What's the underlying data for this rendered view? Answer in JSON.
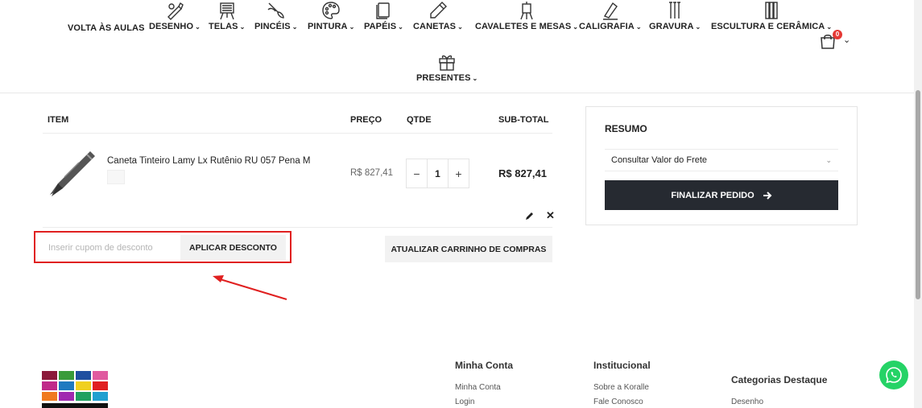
{
  "nav": {
    "items": [
      {
        "label": "VOLTA ÀS AULAS",
        "icon": "back-to-school-icon",
        "chevron": false
      },
      {
        "label": "DESENHO",
        "icon": "drawing-icon",
        "chevron": true
      },
      {
        "label": "TELAS",
        "icon": "canvas-easel-icon",
        "chevron": true
      },
      {
        "label": "PINCÉIS",
        "icon": "brush-icon",
        "chevron": true
      },
      {
        "label": "PINTURA",
        "icon": "palette-icon",
        "chevron": true
      },
      {
        "label": "PAPÉIS",
        "icon": "paper-icon",
        "chevron": true
      },
      {
        "label": "CANETAS",
        "icon": "pen-icon",
        "chevron": true
      },
      {
        "label": "CAVALETES E MESAS",
        "icon": "easel-icon",
        "chevron": true
      },
      {
        "label": "CALIGRAFIA",
        "icon": "calligraphy-icon",
        "chevron": true
      },
      {
        "label": "GRAVURA",
        "icon": "engraving-icon",
        "chevron": true
      },
      {
        "label": "ESCULTURA E CERÂMICA",
        "icon": "sculpture-icon",
        "chevron": true
      },
      {
        "label": "PRESENTES",
        "icon": "gift-icon",
        "chevron": true
      }
    ],
    "cart_count": "0"
  },
  "cart": {
    "headers": {
      "item": "ITEM",
      "price": "PREÇO",
      "qty": "QTDE",
      "subtotal": "SUB-TOTAL"
    },
    "product": {
      "name": "Caneta Tinteiro Lamy Lx Rutênio RU 057 Pena M",
      "price": "R$ 827,41",
      "qty": "1",
      "subtotal": "R$ 827,41"
    },
    "coupon_placeholder": "Inserir cupom de desconto",
    "coupon_button": "APLICAR DESCONTO",
    "update_button": "ATUALIZAR CARRINHO DE COMPRAS"
  },
  "summary": {
    "title": "RESUMO",
    "freight_label": "Consultar Valor do Frete",
    "checkout_label": "FINALIZAR PEDIDO"
  },
  "footer": {
    "col1": {
      "title": "Minha Conta",
      "links": [
        "Minha Conta",
        "Login"
      ]
    },
    "col2": {
      "title": "Institucional",
      "links": [
        "Sobre a Koralle",
        "Fale Conosco"
      ]
    },
    "col3": {
      "title": "Categorias Destaque",
      "links": [
        "Desenho"
      ]
    }
  },
  "colors": {
    "accent_red": "#e02020",
    "dark_button": "#262a31",
    "whatsapp": "#25d366"
  }
}
